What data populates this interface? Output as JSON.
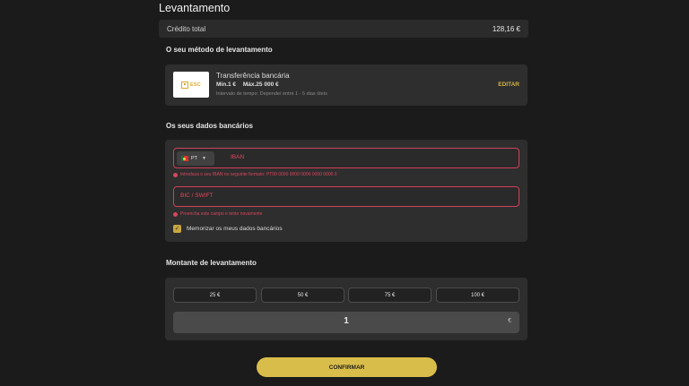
{
  "page_title": "Levantamento",
  "credit": {
    "label": "Crédito total",
    "value": "128,16 €"
  },
  "method_section": {
    "title": "O seu método de levantamento"
  },
  "method": {
    "logo_text": "ESC",
    "name": "Transferência bancária",
    "min": "Mín.1 €",
    "max": "Máx.25 000 €",
    "time": "Intervalo de tempo: Depende/ entre 1 - 5 dias úteis",
    "edit_label": "EDITAR"
  },
  "bank_section": {
    "title": "Os seus dados bancários"
  },
  "bank": {
    "country_code": "PT",
    "iban_placeholder": "IBAN",
    "iban_error": "Introduza o seu IBAN no seguinte formato: PT00 0000 0000 0000 0000 0000 0",
    "bic_placeholder": "BIC / SWIFT",
    "bic_error": "Preencha este campo e tente novamente",
    "remember_label": "Memorizar os meus dados bancários",
    "remember_checked": true
  },
  "amount_section": {
    "title": "Montante de levantamento"
  },
  "amount": {
    "presets": [
      "25 €",
      "50 €",
      "75 €",
      "100 €"
    ],
    "value": "1",
    "currency": "€"
  },
  "confirm_label": "CONFIRMAR",
  "colors": {
    "accent": "#d9bd4a",
    "error": "#d0415a",
    "background": "#1b1b1b",
    "card": "#2e2e2e"
  }
}
